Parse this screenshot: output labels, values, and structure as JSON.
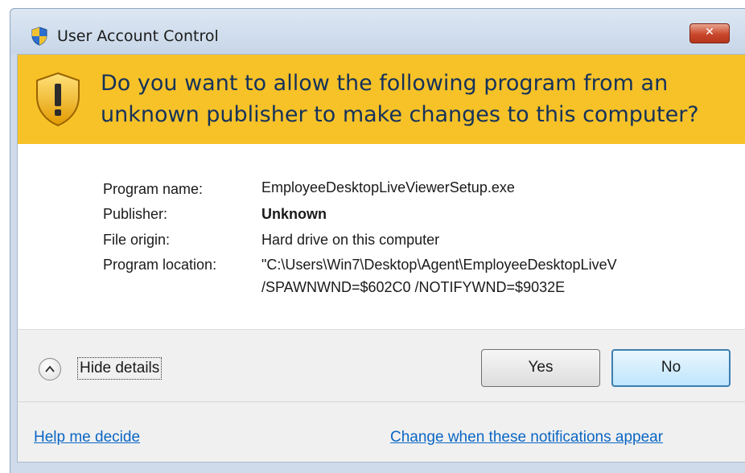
{
  "window": {
    "title": "User Account Control",
    "title_icon": "uac-shield-icon",
    "close_icon": "close-icon"
  },
  "banner": {
    "icon": "warning-shield-icon",
    "line1": "Do you want to allow the following program from an",
    "line2": "unknown publisher to make changes to this computer?"
  },
  "details": {
    "program_name_label": "Program name:",
    "program_name_value": "EmployeeDesktopLiveViewerSetup.exe",
    "publisher_label": "Publisher:",
    "publisher_value": "Unknown",
    "file_origin_label": "File origin:",
    "file_origin_value": "Hard drive on this computer",
    "program_location_label": "Program location:",
    "program_location_line1": "\"C:\\Users\\Win7\\Desktop\\Agent\\EmployeeDesktopLiveV",
    "program_location_line2": "/SPAWNWND=$602C0 /NOTIFYWND=$9032E"
  },
  "footer": {
    "hide_details": "Hide details",
    "yes_label": "Yes",
    "no_label": "No",
    "help_link": "Help me decide",
    "change_link": "Change when these notifications appear"
  },
  "colors": {
    "banner_bg": "#f7c228",
    "banner_text": "#15325a",
    "link": "#0b66c4",
    "footer_bg": "#f0f0f0"
  }
}
